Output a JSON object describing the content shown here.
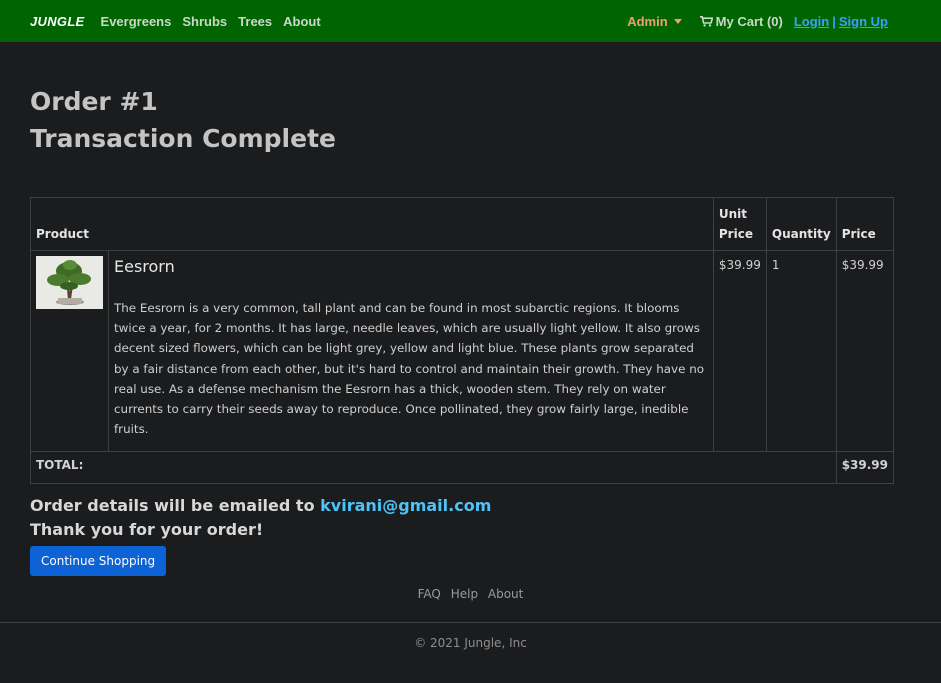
{
  "navbar": {
    "brand": "JUNGLE",
    "links": [
      "Evergreens",
      "Shrubs",
      "Trees",
      "About"
    ],
    "admin_label": "Admin",
    "cart_label": "My Cart (0)",
    "login_label": "Login",
    "separator": "|",
    "signup_label": "Sign Up",
    "colors": {
      "bar": "#006400",
      "admin": "#f0a070",
      "auth_links": "#3aa0ff"
    }
  },
  "order": {
    "number_title": "Order #1",
    "status_title": "Transaction Complete",
    "table": {
      "headers": {
        "product": "Product",
        "unit_price": "Unit Price",
        "quantity": "Quantity",
        "price": "Price"
      },
      "items": [
        {
          "name": "Eesrorn",
          "description": "The Eesrorn is a very common, tall plant and can be found in most subarctic regions. It blooms twice a year, for 2 months. It has large, needle leaves, which are usually light yellow. It also grows decent sized flowers, which can be light grey, yellow and light blue. These plants grow separated by a fair distance from each other, but it's hard to control and maintain their growth. They have no real use. As a defense mechanism the Eesrorn has a thick, wooden stem. They rely on water currents to carry their seeds away to reproduce. Once pollinated, they grow fairly large, inedible fruits.",
          "image_icon": "bonsai-tree-image",
          "unit_price": "$39.99",
          "quantity": "1",
          "price": "$39.99"
        }
      ],
      "total_label": "TOTAL:",
      "total_value": "$39.99"
    },
    "email_prefix": "Order details will be emailed to",
    "email": "kvirani@gmail.com",
    "thanks": "Thank you for your order!",
    "continue_button": "Continue Shopping"
  },
  "footer": {
    "links": [
      "FAQ",
      "Help",
      "About"
    ],
    "copyright": "© 2021 Jungle, Inc"
  },
  "colors": {
    "background": "#1b1c1e",
    "button": "#0d62d6",
    "email": "#4fc3f7"
  }
}
